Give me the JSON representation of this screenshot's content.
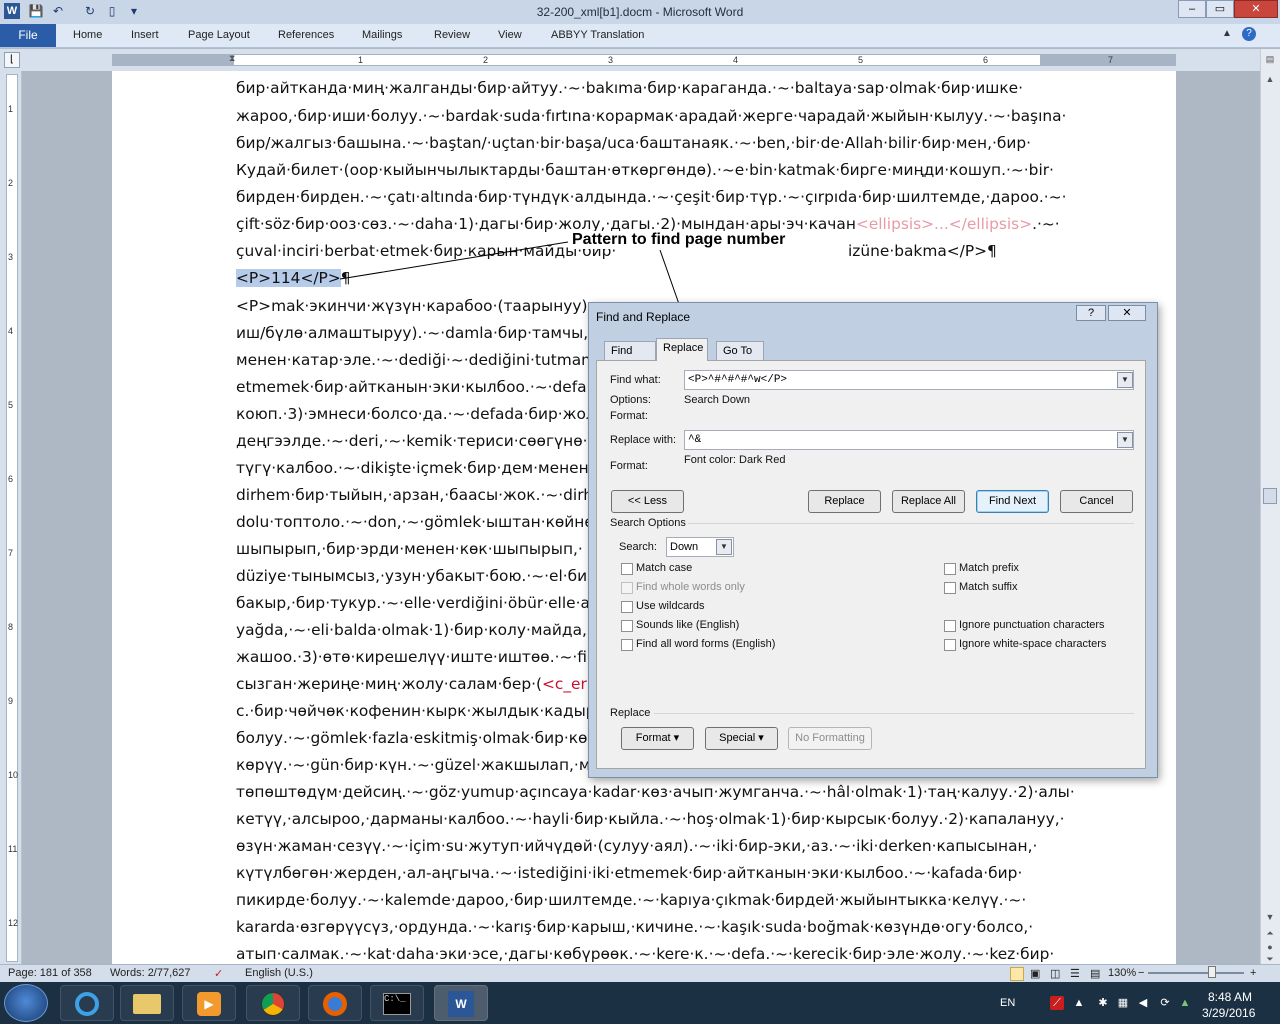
{
  "window": {
    "title": "32-200_xml[b1].docm - Microsoft Word",
    "minimize": "–",
    "maximize": "▭",
    "close": "✕",
    "ribbon_collapse": "▲",
    "help": "?"
  },
  "ribbon": {
    "file": "File",
    "tabs": [
      "Home",
      "Insert",
      "Page Layout",
      "References",
      "Mailings",
      "Review",
      "View",
      "ABBYY Translation"
    ]
  },
  "ruler": {
    "marks": [
      "1",
      "2",
      "3",
      "4",
      "5",
      "6",
      "7"
    ],
    "v_marks": [
      "1",
      "2",
      "3",
      "4",
      "5",
      "6",
      "7",
      "8",
      "9",
      "10",
      "11",
      "12"
    ]
  },
  "document": {
    "lines": [
      {
        "text": "бир·айтканда·миң·жалганды·бир·айтуу.·~·bakıma·бир·караганда.·~·baltaya·sap·olmak·бир·ишке·"
      },
      {
        "text": "жароо,·бир·иши·болуу.·~·bardak·suda·fırtına·корармак·арадай·жерге·чарадай·жыйын·кылуу.·~·başına·"
      },
      {
        "text": "бир/жалгыз·башына.·~·baştan/·uçtan·bir·başa/uca·баштанаяк.·~·ben,·bir·de·Allah·bilir·бир·мен,·бир·"
      },
      {
        "text": "Кудай·билет·(оор·кыйынчылыктарды·баштан·өткөргөндө).·~e·bin·katmak·бирге·миңди·кошуп.·~·bir·"
      },
      {
        "text": "бирден·бирден.·~·çatı·altında·бир·түндүк·алдында.·~·çeşit·бир·түр.·~·çırpıda·бир·шилтемде,·дароо.·~·"
      },
      {
        "text": "çift·söz·бир·ооз·сөз.·~·daha·1)·дагы·бир·жолу,·дагы.·2)·мындан·ары·эч·качан",
        "pink": "<ellipsis>...</ellipsis>",
        "tail": ".·~·"
      },
      {
        "text": "çuval·inciri·berbat·etmek·бир·карын·майды·бир·",
        "gap": true,
        "tail": "izüne·bakma</P>¶"
      },
      {
        "hl": "<P>114</P>",
        "tail": "¶"
      },
      {
        "text": "<P>mak·экинчи·жүзүн·карабоо·(таарынуу).·~"
      },
      {
        "text": "иш/бүлө·алмаштыруу).·~·damla·бир·тамчы,·"
      },
      {
        "text": "менен·катар·эле.·~·dediği·~·dediğini·tutmama"
      },
      {
        "text": "etmemek·бир·айтканын·эки·кылбоо.·~·defa·"
      },
      {
        "text": "коюп.·3)·эмнеси·болсо·да.·~·defada·бир·жол"
      },
      {
        "text": "деңгээлде.·~·deri,·~·kemik·териси·сөөгүнө·жа"
      },
      {
        "text": "түгү·калбоо.·~·dikişte·içmek·бир·дем·менен·"
      },
      {
        "text": "dirhem·бир·тыйын,·арзан,·баасы·жок.·~·dirh"
      },
      {
        "text": "dolu·топтоло.·~·don,·~·gömlek·ыштан·көйнө"
      },
      {
        "text": "шыпырып,·бир·эрди·менен·көк·шыпырып,·"
      },
      {
        "text": "düziye·тынымсыз,·узун·убакыт·бою.·~·el·бир"
      },
      {
        "text": "бакыр,·бир·тукур.·~·elle·verdiğini·öbür·elle·al"
      },
      {
        "text": "yağda,·~·eli·balda·olmak·1)·бир·колу·майда,·б"
      },
      {
        "text": "жашоо.·3)·өтө·кирешелүү·иште·иштөө.·~·fin"
      },
      {
        "text": "сызган·жериңе·миң·жолу·салам·бер·(",
        "red": "<c_err"
      },
      {
        "text": "с.·бир·чөйчөк·кофенин·кырк·жылдык·кадыр"
      },
      {
        "text": "болуу.·~·gömlek·fazla·eskitmiş·olmak·бир·көй"
      },
      {
        "text": "көрүү.·~·gün·бир·күн.·~·güzel·жакшылап,·мы"
      },
      {
        "text": "төпөштөдүм·дейсиң.·~·göz·yumup·açıncaya·kadar·көз·ачып·жумганча.·~·hâl·olmak·1)·таң·калуу.·2)·алы·"
      },
      {
        "text": "кетүү,·алсыроо,·дарманы·калбоо.·~·hayli·бир·кыйла.·~·hoş·olmak·1)·бир·кырсык·болуу.·2)·капалануу,·"
      },
      {
        "text": "өзүн·жаман·сезүү.·~·içim·su·жутуп·ийчүдөй·(сулуу·аял).·~·iki·бир-эки,·аз.·~·iki·derken·капысынан,·"
      },
      {
        "text": "күтүлбөгөн·жерден,·ал-аңгыча.·~·istediğini·iki·etmemek·бир·айтканын·эки·кылбоо.·~·kafada·бир·"
      },
      {
        "text": "пикирде·болуу.·~·kalemde·дароо,·бир·шилтемде.·~·kapıya·çıkmak·бирдей·жыйынтыкка·келүү.·~·"
      },
      {
        "text": "kararda·өзгөрүүсүз,·ордунда.·~·karış·бир·карыш,·кичине.·~·kaşık·suda·boğmak·көзүндө·огу·болсо,·"
      },
      {
        "text": "атып·салмак.·~·kat·daha·эки·эсе,·дагы·көбүрөөк.·~·kere·к.·~·defa.·~·kerecik·бир·эле·жолу.·~·kez·бир·"
      }
    ]
  },
  "annotation": {
    "callout": "Pattern to find page number"
  },
  "dialog": {
    "title": "Find and Replace",
    "help": "?",
    "close": "✕",
    "tabs": [
      "Find",
      "Replace",
      "Go To"
    ],
    "find_label": "Find what:",
    "find_value": "<P>^#^#^#^w</P>",
    "options_label": "Options:",
    "options_value": "Search Down",
    "format_label": "Format:",
    "replace_label": "Replace with:",
    "replace_value": "^&",
    "replace_format_label": "Format:",
    "replace_format_value": "Font color: Dark Red",
    "buttons": {
      "less": "<< Less",
      "replace": "Replace",
      "replace_all": "Replace All",
      "find_next": "Find Next",
      "cancel": "Cancel"
    },
    "search_options_label": "Search Options",
    "search_label": "Search:",
    "search_value": "Down",
    "checkboxes_left": [
      {
        "label": "Match case",
        "disabled": false
      },
      {
        "label": "Find whole words only",
        "disabled": true
      },
      {
        "label": "Use wildcards",
        "disabled": false
      },
      {
        "label": "Sounds like (English)",
        "disabled": false
      },
      {
        "label": "Find all word forms (English)",
        "disabled": false
      }
    ],
    "checkboxes_right": [
      {
        "label": "Match prefix"
      },
      {
        "label": "Match suffix"
      },
      {
        "label": "Ignore punctuation characters"
      },
      {
        "label": "Ignore white-space characters"
      }
    ],
    "replace_section_label": "Replace",
    "format_button": "Format ▾",
    "special_button": "Special ▾",
    "no_formatting_button": "No Formatting"
  },
  "status": {
    "page": "Page: 181 of 358",
    "words": "Words: 2/77,627",
    "language": "English (U.S.)",
    "zoom": "130%",
    "zoom_minus": "−",
    "zoom_plus": "+"
  },
  "taskbar": {
    "lang": "EN",
    "time": "8:48 AM",
    "date": "3/29/2016"
  }
}
